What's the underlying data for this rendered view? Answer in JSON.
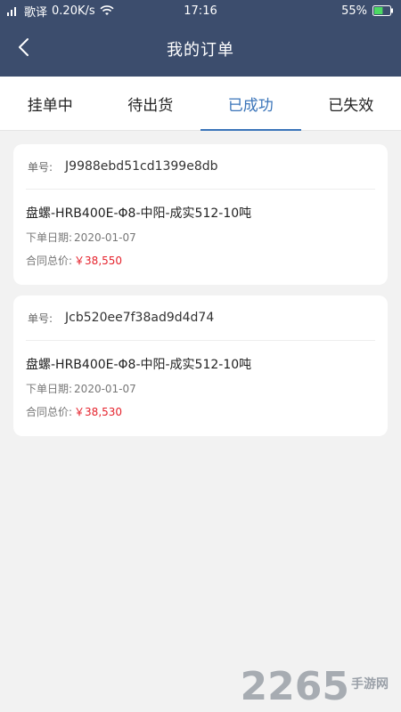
{
  "status_bar": {
    "carrier": "歌译",
    "speed": "0.20K/s",
    "time": "17:16",
    "battery": "55%",
    "battery_level": 0.55
  },
  "header": {
    "title": "我的订单"
  },
  "tabs": [
    {
      "label": "挂单中",
      "active": false
    },
    {
      "label": "待出货",
      "active": false
    },
    {
      "label": "已成功",
      "active": true
    },
    {
      "label": "已失效",
      "active": false
    }
  ],
  "orders": [
    {
      "order_label": "单号:",
      "order_no": "J9988ebd51cd1399e8db",
      "product": "盘螺-HRB400E-Φ8-中阳-成实512-10吨",
      "date_label": "下单日期:",
      "date": "2020-01-07",
      "total_label": "合同总价:",
      "total": "￥38,550"
    },
    {
      "order_label": "单号:",
      "order_no": "Jcb520ee7f38ad9d4d74",
      "product": "盘螺-HRB400E-Φ8-中阳-成实512-10吨",
      "date_label": "下单日期:",
      "date": "2020-01-07",
      "total_label": "合同总价:",
      "total": "￥38,530"
    }
  ],
  "watermark": {
    "number": "2265",
    "text": "手游网"
  },
  "colors": {
    "header_bg": "#3c4d6d",
    "accent": "#3a74b9",
    "price": "#e5222c",
    "page_bg": "#f2f2f2"
  }
}
